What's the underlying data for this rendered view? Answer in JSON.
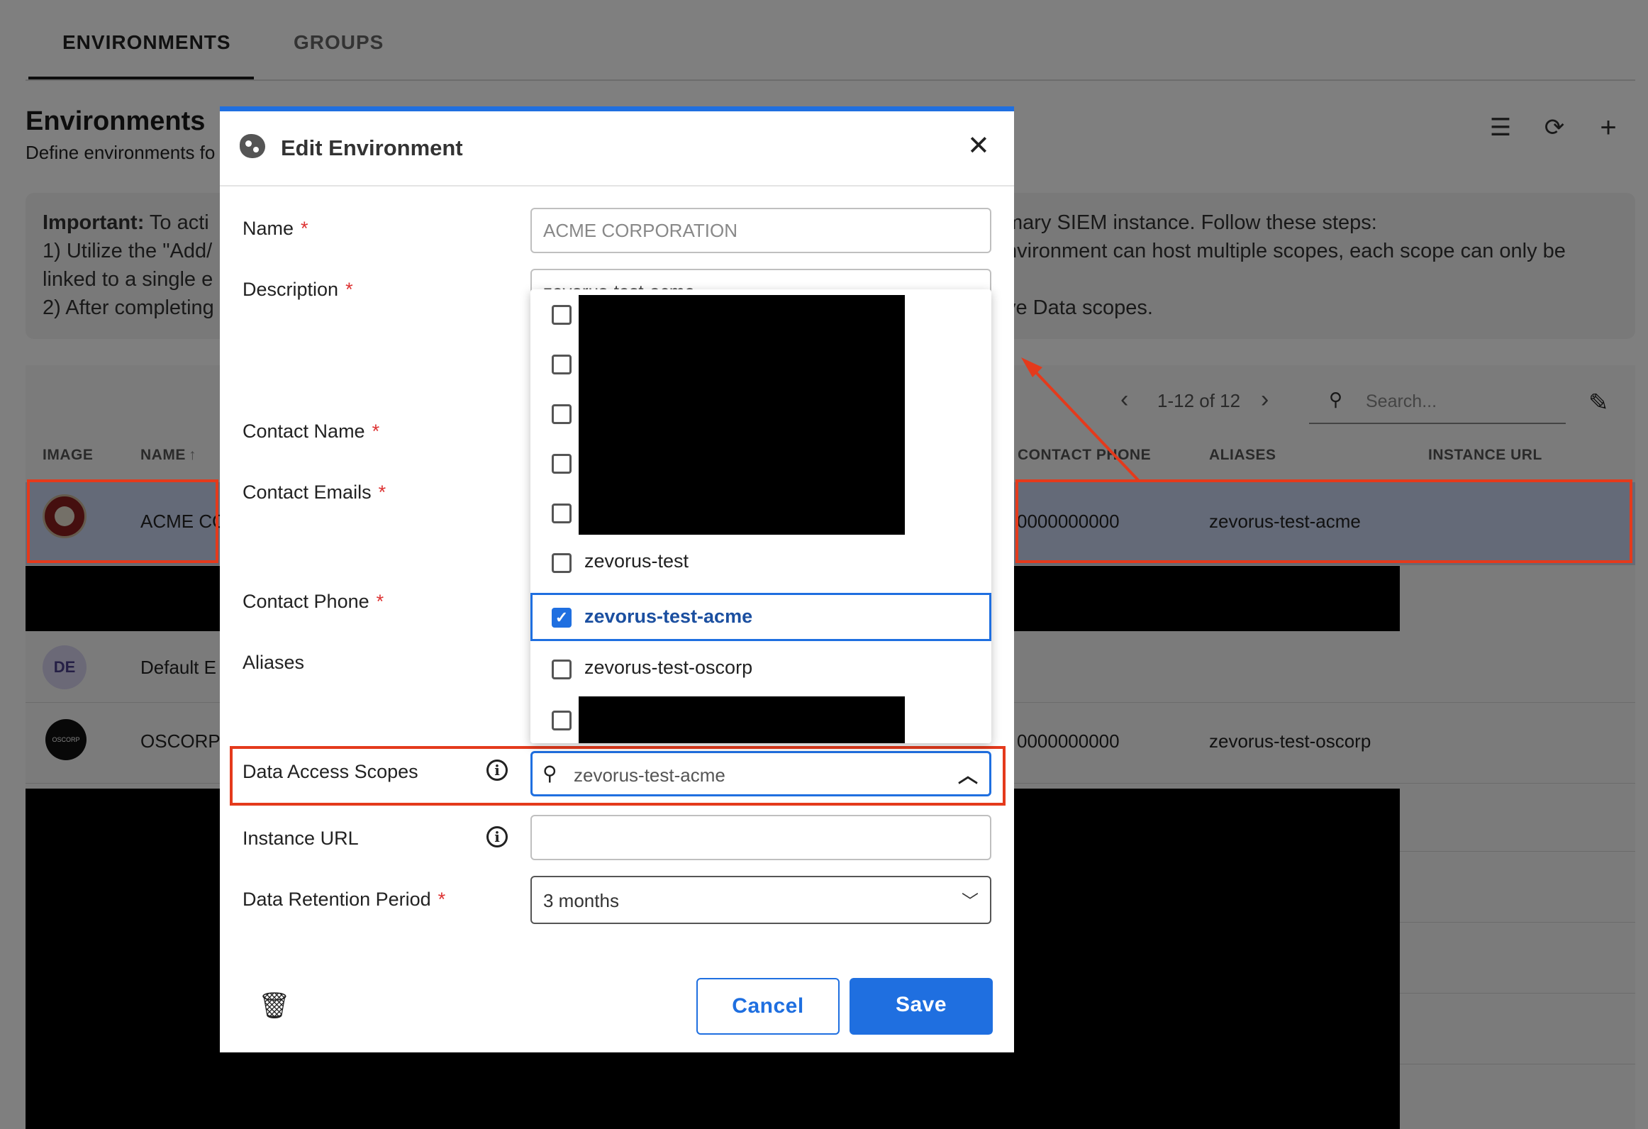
{
  "tabs": [
    {
      "label": "ENVIRONMENTS"
    },
    {
      "label": "GROUPS"
    }
  ],
  "page": {
    "title": "Environments",
    "subtitle": "Define environments fo"
  },
  "info": {
    "bold": "Important:",
    "line1": "To acti",
    "line1_right": "mary SIEM instance. Follow these steps:",
    "line2": "1) Utilize the \"Add/",
    "line2_right": "nvironment can host multiple scopes, each scope can only be",
    "line3": "linked to a single e",
    "line4": "2) After completing",
    "line4_right": "ve Data scopes."
  },
  "pagination": {
    "text": "1-12 of 12",
    "search_placeholder": "Search..."
  },
  "table": {
    "headers": {
      "image": "IMAGE",
      "name": "NAME",
      "contact_phone": "CONTACT PHONE",
      "aliases": "ALIASES",
      "instance_url": "INSTANCE URL"
    },
    "rows": [
      {
        "name": "ACME CO",
        "phone": "0000000000",
        "alias": "zevorus-test-acme"
      },
      {
        "avatar": "DE",
        "name": "Default E"
      },
      {
        "name": "OSCORP",
        "phone": "0000000000",
        "alias": "zevorus-test-oscorp",
        "logo": "OSCORP"
      }
    ]
  },
  "modal": {
    "title": "Edit Environment",
    "fields": {
      "name_label": "Name",
      "name_value": "ACME CORPORATION",
      "description_label": "Description",
      "description_value": "zevorus-test-acme",
      "contact_name_label": "Contact Name",
      "contact_emails_label": "Contact Emails",
      "contact_phone_label": "Contact Phone",
      "aliases_label": "Aliases",
      "data_access_scopes_label": "Data Access Scopes",
      "data_access_scopes_value": "zevorus-test-acme",
      "instance_url_label": "Instance URL",
      "instance_url_value": "",
      "retention_label": "Data Retention Period",
      "retention_value": "3 months",
      "required_mark": "*"
    },
    "dropdown_options": [
      {
        "label": "zevorus-test",
        "checked": false
      },
      {
        "label": "zevorus-test-acme",
        "checked": true
      },
      {
        "label": "zevorus-test-oscorp",
        "checked": false
      }
    ],
    "buttons": {
      "cancel": "Cancel",
      "save": "Save"
    }
  },
  "icons": {
    "close": "close-icon",
    "delete": "trash-icon",
    "search": "search-icon",
    "chevron_up": "chevron-up-icon",
    "chevron_down": "chevron-down-icon",
    "info": "info-icon",
    "list": "list-icon",
    "refresh": "refresh-icon",
    "add": "plus-icon",
    "edit": "pencil-icon"
  },
  "colors": {
    "accent": "#1f6fe0",
    "annotation": "#e43a1c",
    "selected_row": "#c9d4f0"
  }
}
